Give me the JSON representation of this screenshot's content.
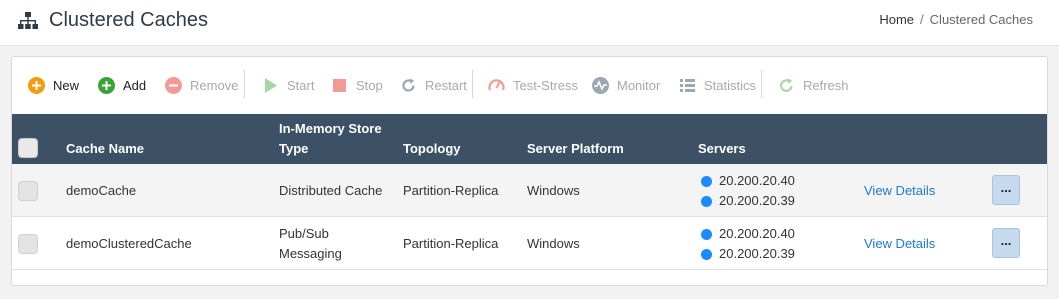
{
  "page": {
    "title": "Clustered Caches"
  },
  "breadcrumb": {
    "home": "Home",
    "separator": "/",
    "current": "Clustered Caches"
  },
  "toolbar": {
    "new": {
      "label": "New",
      "enabled": true,
      "icon": "plus-circle-icon",
      "color": "#f39c12"
    },
    "add": {
      "label": "Add",
      "enabled": true,
      "icon": "plus-circle-icon",
      "color": "#3aa335"
    },
    "remove": {
      "label": "Remove",
      "enabled": false,
      "icon": "minus-circle-icon",
      "color": "#e53935"
    },
    "start": {
      "label": "Start",
      "enabled": false,
      "icon": "play-icon",
      "color": "#4caf50"
    },
    "stop": {
      "label": "Stop",
      "enabled": false,
      "icon": "stop-icon",
      "color": "#e53935"
    },
    "restart": {
      "label": "Restart",
      "enabled": false,
      "icon": "refresh-icon",
      "color": "#3d5166"
    },
    "test_stress": {
      "label": "Test-Stress",
      "enabled": false,
      "icon": "gauge-icon",
      "color": "#e53935"
    },
    "monitor": {
      "label": "Monitor",
      "enabled": false,
      "icon": "monitor-icon",
      "color": "#3d5166"
    },
    "statistics": {
      "label": "Statistics",
      "enabled": false,
      "icon": "list-icon",
      "color": "#3d5166"
    },
    "refresh": {
      "label": "Refresh",
      "enabled": false,
      "icon": "refresh-icon",
      "color": "#4caf50"
    }
  },
  "table": {
    "headers": {
      "cache_name": "Cache Name",
      "store_type_line1": "In-Memory Store",
      "store_type_line2": "Type",
      "topology": "Topology",
      "server_platform": "Server Platform",
      "servers": "Servers"
    },
    "rows": [
      {
        "cache_name": "demoCache",
        "store_type_line1": "Distributed Cache",
        "store_type_line2": "",
        "topology": "Partition-Replica",
        "server_platform": "Windows",
        "servers": [
          "20.200.20.40",
          "20.200.20.39"
        ],
        "view_details": "View Details",
        "more": "..."
      },
      {
        "cache_name": "demoClusteredCache",
        "store_type_line1": "Pub/Sub",
        "store_type_line2": "Messaging",
        "topology": "Partition-Replica",
        "server_platform": "Windows",
        "servers": [
          "20.200.20.40",
          "20.200.20.39"
        ],
        "view_details": "View Details",
        "more": "..."
      }
    ]
  },
  "colors": {
    "header_bg": "#3d5166",
    "link": "#1e7ad6",
    "server_status": "#1a8cff"
  }
}
